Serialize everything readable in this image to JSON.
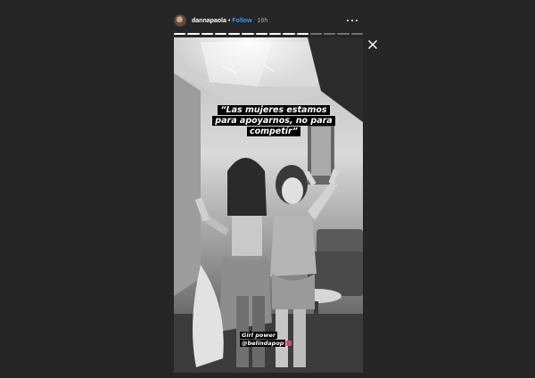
{
  "header": {
    "username": "dannapaola",
    "separator": "•",
    "follow_label": "Follow",
    "time": "16h"
  },
  "progress": {
    "total_segments": 14,
    "completed_segments": 10
  },
  "story": {
    "quote_lines": [
      "“Las mujeres estamos",
      "para apoyarnos, no para",
      "competír”"
    ],
    "caption": "Girl power",
    "mention": "@belindapop"
  },
  "icons": {
    "avatar": "avatar-image",
    "more": "more-options-icon",
    "close": "close-icon",
    "heart": "heart-sticker-icon"
  },
  "colors": {
    "background": "#262626",
    "follow": "#3897f0",
    "heart": "#e0407a"
  }
}
